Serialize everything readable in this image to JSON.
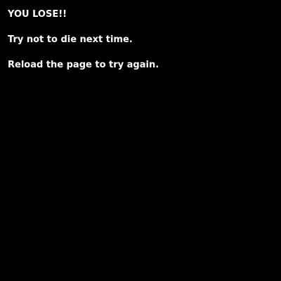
{
  "game_over": {
    "title": "YOU LOSE!!",
    "message": "Try not to die next time.",
    "instruction": "Reload the page to try again."
  },
  "colors": {
    "background": "#000000",
    "text": "#ffffff"
  }
}
